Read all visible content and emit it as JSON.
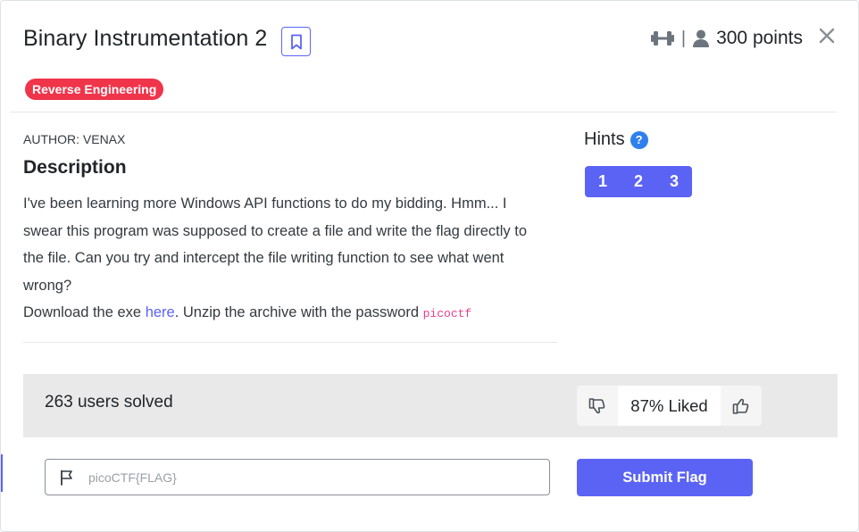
{
  "challenge": {
    "title": "Binary Instrumentation 2",
    "points": "300 points",
    "separator": "|",
    "category": "Reverse Engineering",
    "author": "AUTHOR: VENAX",
    "description_heading": "Description",
    "description_paragraph": "I've been learning more Windows API functions to do my bidding. Hmm... I swear this program was supposed to create a file and write the flag directly to the file. Can you try and intercept the file writing function to see what went wrong?",
    "download_prefix": "Download the exe ",
    "download_link": "here",
    "download_middle": ". Unzip the archive with the password ",
    "password": "picoctf"
  },
  "hints": {
    "title": "Hints",
    "help_glyph": "?",
    "items": [
      {
        "label": "1"
      },
      {
        "label": "2"
      },
      {
        "label": "3"
      }
    ]
  },
  "stats": {
    "solved": "263 users solved",
    "liked": "87% Liked"
  },
  "flag_form": {
    "placeholder": "picoCTF{FLAG}",
    "submit_label": "Submit Flag"
  },
  "colors": {
    "primary": "#5b63f5",
    "tag": "#f0344a",
    "hint_help": "#2f80ed",
    "code": "#e83e8c",
    "solved_bar": "#e9e9e9"
  },
  "icons": {
    "bookmark": "bookmark-icon",
    "difficulty": "dumbbell-icon",
    "user": "user-icon",
    "close": "close-icon",
    "thumbs_down": "thumbs-down-icon",
    "thumbs_up": "thumbs-up-icon",
    "flag": "flag-icon"
  }
}
